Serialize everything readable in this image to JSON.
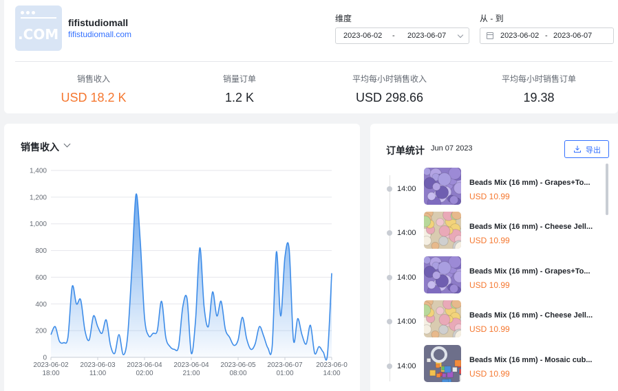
{
  "shop": {
    "name": "fifistudiomall",
    "url": "fifistudiomall.com",
    "logo_text": ".COM"
  },
  "filters": {
    "dimension_label": "维度",
    "dimension_start": "2023-06-02",
    "dimension_sep": "-",
    "dimension_end": "2023-06-07",
    "range_label": "从 - 到",
    "range_start": "2023-06-02",
    "range_sep": "-",
    "range_end": "2023-06-07"
  },
  "metrics": [
    {
      "label": "销售收入",
      "value": "USD 18.2 K"
    },
    {
      "label": "销量订单",
      "value": "1.2 K"
    },
    {
      "label": "平均每小时销售收入",
      "value": "USD 298.66"
    },
    {
      "label": "平均每小时销售订单",
      "value": "19.38"
    }
  ],
  "colors": {
    "accent": "#3370ff",
    "highlight": "#f5772f",
    "line": "#3d8ce8"
  },
  "chart_panel": {
    "title": "销售收入"
  },
  "chart_data": {
    "type": "area",
    "ylim": [
      0,
      1400
    ],
    "y_ticks": [
      "0",
      "200",
      "400",
      "600",
      "800",
      "1,000",
      "1,200",
      "1,400"
    ],
    "x_ticks": [
      [
        "2023-06-02",
        "18:00"
      ],
      [
        "2023-06-03",
        "11:00"
      ],
      [
        "2023-06-04",
        "02:00"
      ],
      [
        "2023-06-04",
        "21:00"
      ],
      [
        "2023-06-05",
        "08:00"
      ],
      [
        "2023-06-07",
        "01:00"
      ],
      [
        "2023-06-0",
        "14:00"
      ]
    ],
    "grid": true,
    "values": [
      170,
      230,
      120,
      110,
      150,
      530,
      400,
      430,
      200,
      130,
      310,
      230,
      180,
      280,
      90,
      30,
      170,
      20,
      150,
      650,
      1220,
      870,
      300,
      160,
      180,
      200,
      420,
      150,
      80,
      60,
      80,
      380,
      440,
      30,
      280,
      820,
      380,
      230,
      490,
      310,
      420,
      210,
      150,
      90,
      130,
      300,
      140,
      60,
      100,
      230,
      160,
      70,
      80,
      790,
      310,
      750,
      810,
      130,
      290,
      170,
      100,
      240,
      30,
      80,
      40,
      20,
      630
    ]
  },
  "orders_panel": {
    "title": "订单统计",
    "date": "Jun 07 2023",
    "export_label": "导出",
    "items": [
      {
        "time": "14:00",
        "name": "Beads Mix (16 mm) - Grapes+To...",
        "price": "USD 10.99",
        "thumb": "purple"
      },
      {
        "time": "14:00",
        "name": "Beads Mix (16 mm) - Cheese Jell...",
        "price": "USD 10.99",
        "thumb": "mixed"
      },
      {
        "time": "14:00",
        "name": "Beads Mix (16 mm) - Grapes+To...",
        "price": "USD 10.99",
        "thumb": "purple"
      },
      {
        "time": "14:00",
        "name": "Beads Mix (16 mm) - Cheese Jell...",
        "price": "USD 10.99",
        "thumb": "mixed"
      },
      {
        "time": "14:00",
        "name": "Beads Mix (16 mm) - Mosaic cub...",
        "price": "USD 10.99",
        "thumb": "mosaic"
      }
    ]
  }
}
